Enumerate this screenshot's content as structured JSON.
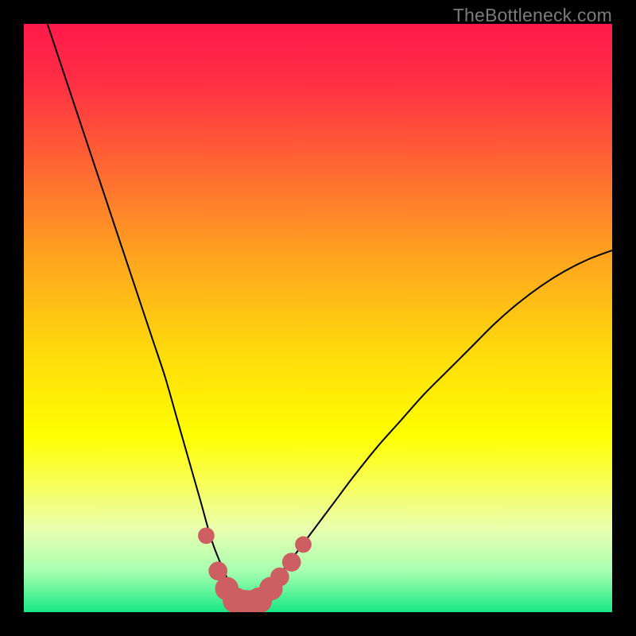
{
  "watermark": "TheBottleneck.com",
  "colors": {
    "frame": "#000000",
    "curve": "#000000",
    "dots": "#cd5f62",
    "dots_stroke": "#cd5f62"
  },
  "chart_data": {
    "type": "line",
    "title": "",
    "xlabel": "",
    "ylabel": "",
    "xlim": [
      0,
      100
    ],
    "ylim": [
      0,
      100
    ],
    "gradient_stops": [
      {
        "offset": 0.0,
        "color": "#ff1a4b"
      },
      {
        "offset": 0.1,
        "color": "#ff2f44"
      },
      {
        "offset": 0.25,
        "color": "#ff6a32"
      },
      {
        "offset": 0.4,
        "color": "#ffa51f"
      },
      {
        "offset": 0.55,
        "color": "#ffd80d"
      },
      {
        "offset": 0.7,
        "color": "#ffff00"
      },
      {
        "offset": 0.78,
        "color": "#f8ff57"
      },
      {
        "offset": 0.86,
        "color": "#e8ffb0"
      },
      {
        "offset": 0.93,
        "color": "#a8ffb0"
      },
      {
        "offset": 1.0,
        "color": "#18e885"
      }
    ],
    "series": [
      {
        "name": "bottleneck-curve",
        "x": [
          4,
          6,
          8,
          10,
          12,
          14,
          16,
          18,
          20,
          22,
          24,
          26,
          28,
          30,
          32,
          34,
          35.5,
          37,
          38.5,
          40,
          42,
          44,
          47,
          50,
          53,
          56,
          60,
          64,
          68,
          72,
          76,
          80,
          84,
          88,
          92,
          96,
          100
        ],
        "y": [
          100,
          94,
          88,
          82,
          76,
          70,
          64,
          58,
          52,
          46,
          40,
          33,
          26,
          19,
          12,
          7,
          4,
          2,
          1.5,
          2,
          4,
          7,
          11,
          15,
          19,
          23,
          28,
          32.5,
          37,
          41,
          45,
          49,
          52.5,
          55.5,
          58,
          60,
          61.5
        ]
      }
    ],
    "dots": {
      "name": "highlight-dots",
      "x": [
        31.0,
        33.0,
        34.5,
        36.0,
        37.5,
        39.0,
        40.0,
        42.0,
        43.5,
        45.5,
        47.5
      ],
      "y": [
        13.0,
        7.0,
        4.0,
        2.0,
        1.5,
        1.5,
        2.0,
        4.0,
        6.0,
        8.5,
        11.5
      ],
      "r": [
        1.4,
        1.6,
        2.0,
        2.2,
        2.3,
        2.3,
        2.2,
        2.0,
        1.6,
        1.6,
        1.4
      ]
    }
  }
}
